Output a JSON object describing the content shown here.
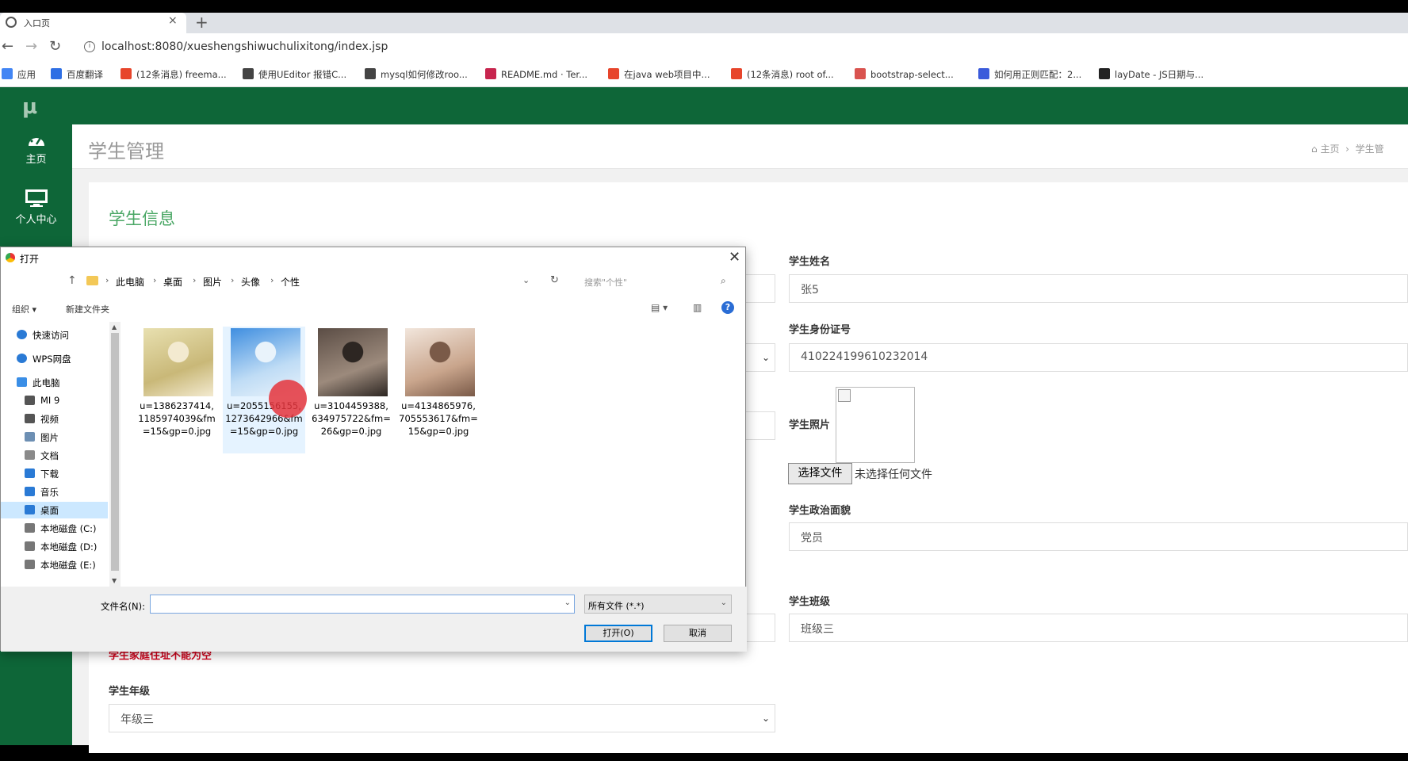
{
  "browser": {
    "tab_title": "入口页",
    "url": "localhost:8080/xueshengshiwuchulixitong/index.jsp",
    "bookmarks": [
      {
        "label": "应用",
        "color": "#4285f4"
      },
      {
        "label": "百度翻译",
        "color": "#2f6fe4"
      },
      {
        "label": "(12条消息) freema...",
        "color": "#e7452b"
      },
      {
        "label": "使用UEditor 报错C...",
        "color": "#444444"
      },
      {
        "label": "mysql如何修改roo...",
        "color": "#444444"
      },
      {
        "label": "README.md · Ter...",
        "color": "#c7254e"
      },
      {
        "label": "在java web项目中...",
        "color": "#e7452b"
      },
      {
        "label": "(12条消息) root of...",
        "color": "#e7452b"
      },
      {
        "label": "bootstrap-select...",
        "color": "#d9534f"
      },
      {
        "label": "如何用正则匹配：2...",
        "color": "#3b5bdb"
      },
      {
        "label": "layDate - JS日期与...",
        "color": "#222222"
      }
    ]
  },
  "app": {
    "logo": "μ",
    "nav": [
      {
        "label": "主页",
        "icon": "dashboard-icon"
      },
      {
        "label": "个人中心",
        "icon": "monitor-icon"
      }
    ],
    "page_title": "学生管理",
    "breadcrumb": {
      "home": "主页",
      "current": "学生管"
    },
    "section_title": "学生信息",
    "form": {
      "name_label": "学生姓名",
      "name_value": "张5",
      "id_label": "学生身份证号",
      "id_value": "410224199610232014",
      "photo_label": "学生照片",
      "file_button": "选择文件",
      "file_status": "未选择任何文件",
      "politics_label": "学生政治面貌",
      "politics_value": "党员",
      "class_label": "学生班级",
      "class_value": "班级三",
      "address_error": "学生家庭住址不能为空",
      "grade_label": "学生年级",
      "grade_value": "年级三"
    }
  },
  "dialog": {
    "title": "打开",
    "path": [
      "此电脑",
      "桌面",
      "图片",
      "头像",
      "个性"
    ],
    "search_placeholder": "搜索\"个性\"",
    "organize": "组织 ▾",
    "new_folder": "新建文件夹",
    "nav_items": [
      {
        "label": "快速访问",
        "icon": "star-icon",
        "color": "#2a7ad5"
      },
      {
        "label": "WPS网盘",
        "icon": "cloud-icon",
        "color": "#2a7ad5"
      },
      {
        "label": "此电脑",
        "icon": "computer-icon",
        "color": "#3a8ee6"
      },
      {
        "label": "MI 9",
        "icon": "phone-icon",
        "color": "#555555"
      },
      {
        "label": "视频",
        "icon": "video-icon",
        "color": "#555555"
      },
      {
        "label": "图片",
        "icon": "pictures-icon",
        "color": "#6d8fb3"
      },
      {
        "label": "文档",
        "icon": "documents-icon",
        "color": "#8a8a8a"
      },
      {
        "label": "下载",
        "icon": "download-icon",
        "color": "#2a7ad5"
      },
      {
        "label": "音乐",
        "icon": "music-icon",
        "color": "#2a7ad5"
      },
      {
        "label": "桌面",
        "icon": "desktop-icon",
        "color": "#2a7ad5"
      },
      {
        "label": "本地磁盘 (C:)",
        "icon": "drive-icon",
        "color": "#777777"
      },
      {
        "label": "本地磁盘 (D:)",
        "icon": "drive-icon",
        "color": "#777777"
      },
      {
        "label": "本地磁盘 (E:)",
        "icon": "drive-icon",
        "color": "#777777"
      }
    ],
    "selected_nav": "桌面",
    "files": [
      {
        "name": "u=1386237414,1185974039&fm=15&gp=0.jpg",
        "palette": [
          "#e8e0b0",
          "#c9b878",
          "#f3ead0"
        ]
      },
      {
        "name": "u=2055156155,1273642966&fm=15&gp=0.jpg",
        "palette": [
          "#3f8ee0",
          "#bfdcf5",
          "#e9f3fb"
        ]
      },
      {
        "name": "u=3104459388,634975722&fm=26&gp=0.jpg",
        "palette": [
          "#5b4d45",
          "#9c8a7c",
          "#2d2622"
        ]
      },
      {
        "name": "u=4134865976,705553617&fm=15&gp=0.jpg",
        "palette": [
          "#f2e6dc",
          "#c9a58c",
          "#7a5a48"
        ]
      }
    ],
    "filename_label": "文件名(N):",
    "filename_value": "",
    "filetype": "所有文件 (*.*)",
    "open_button": "打开(O)",
    "cancel_button": "取消"
  }
}
